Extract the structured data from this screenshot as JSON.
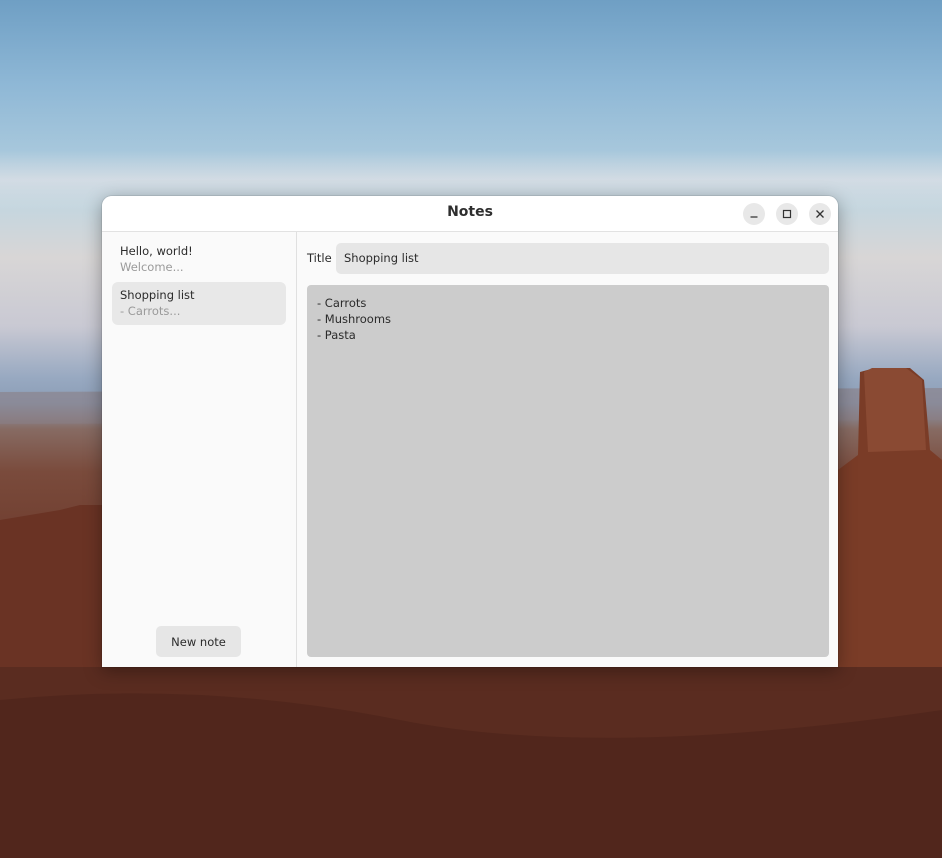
{
  "window": {
    "title": "Notes",
    "controls": {
      "minimize_icon": "minimize-icon",
      "maximize_icon": "maximize-icon",
      "close_icon": "close-icon"
    }
  },
  "sidebar": {
    "notes": [
      {
        "title": "Hello, world!",
        "preview": "Welcome...",
        "selected": false
      },
      {
        "title": "Shopping list",
        "preview": "- Carrots...",
        "selected": true
      }
    ],
    "new_note_label": "New note"
  },
  "editor": {
    "title_label": "Title",
    "title_value": "Shopping list",
    "body_lines": [
      "- Carrots",
      "- Mushrooms",
      "- Pasta"
    ]
  },
  "colors": {
    "selected_item_bg": "#e8e8e8",
    "text_area_bg": "#cccccc",
    "window_bg": "#fafafa"
  }
}
